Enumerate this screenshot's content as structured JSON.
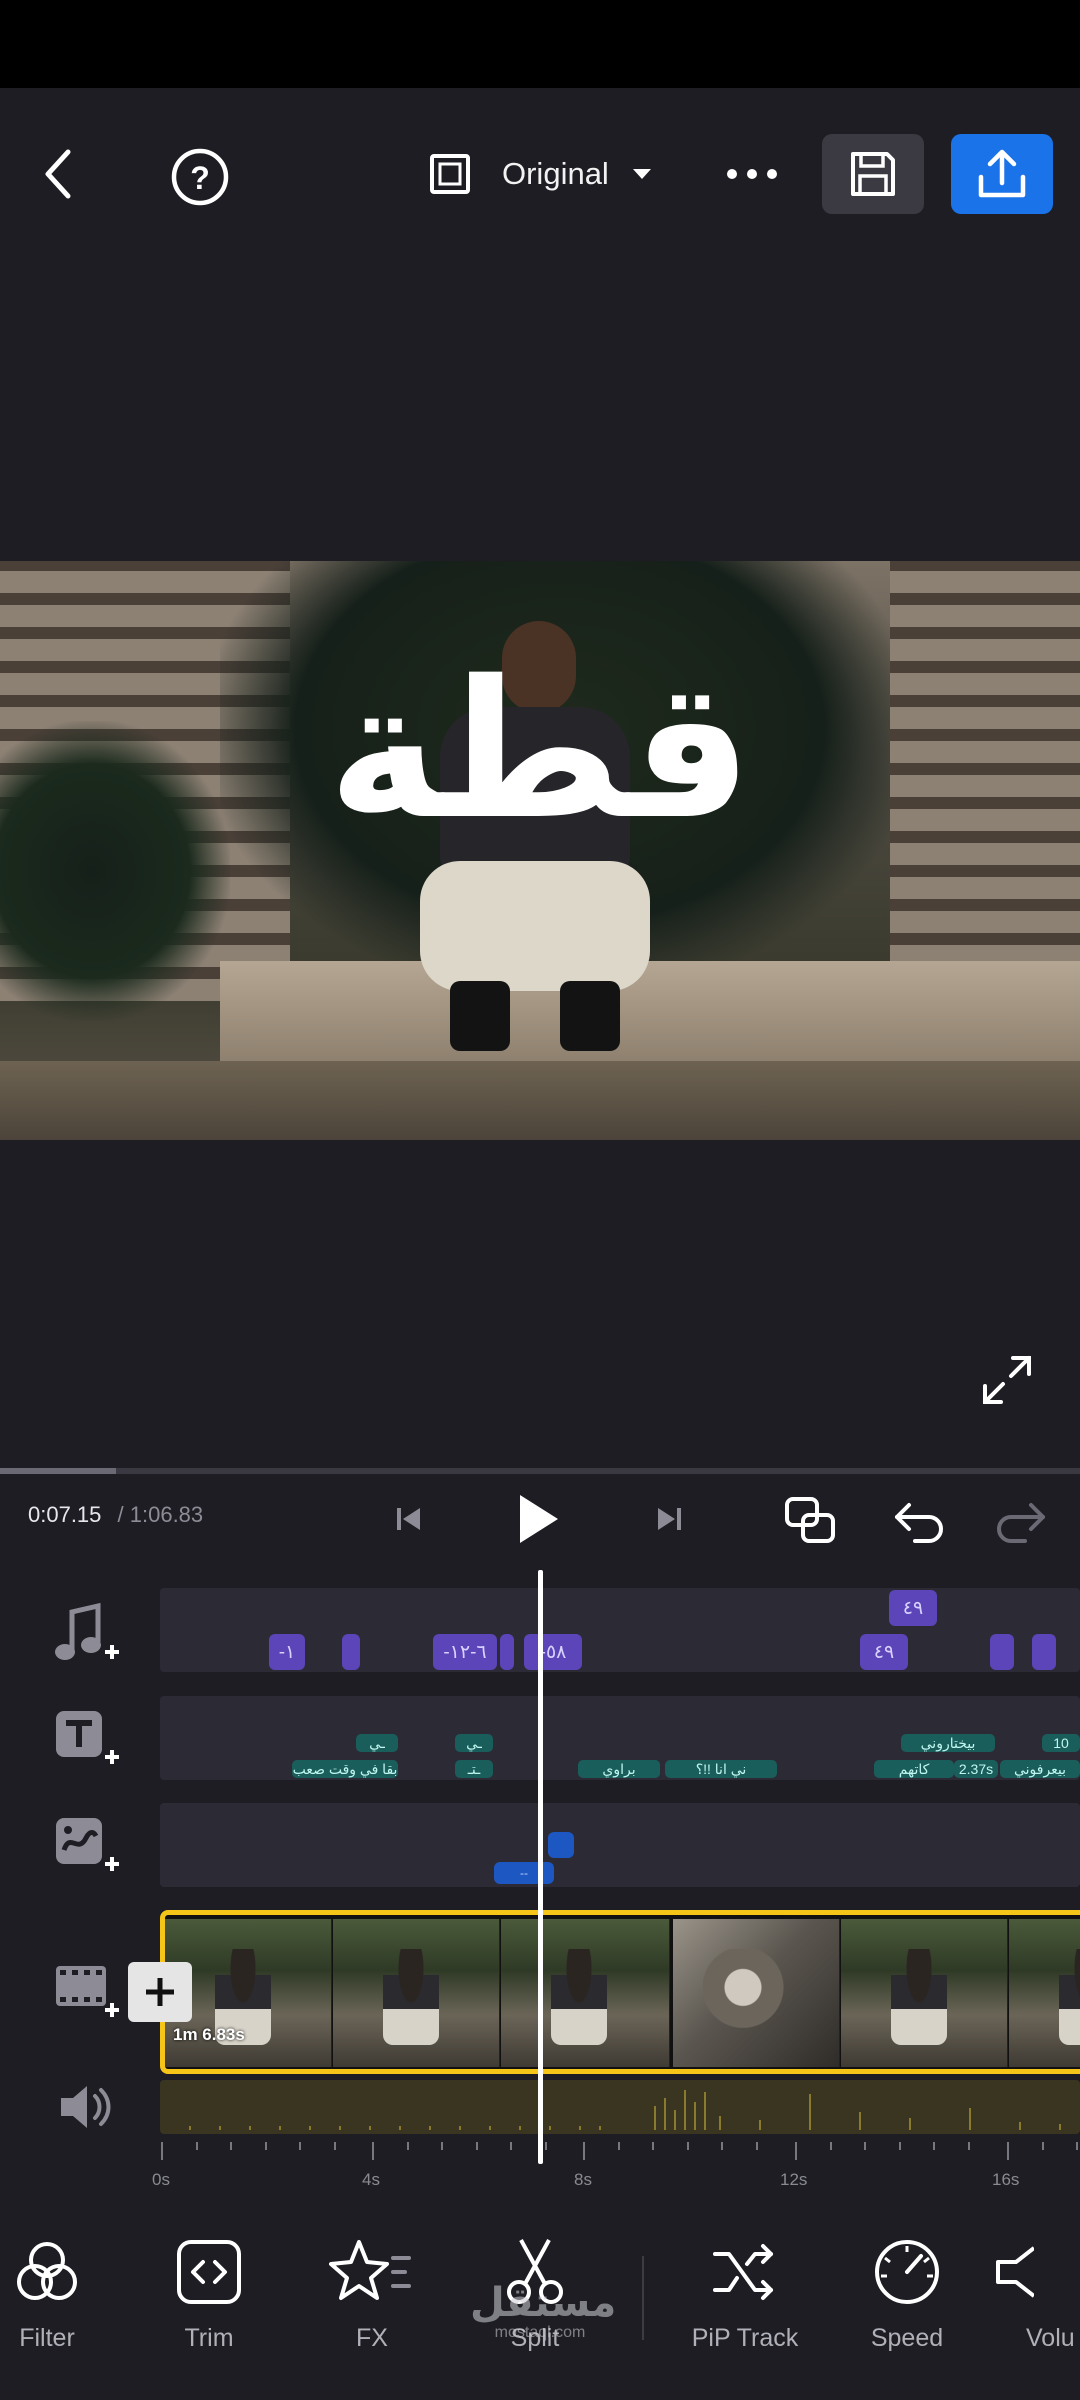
{
  "topbar": {
    "aspect_label": "Original",
    "icons": [
      "back-icon",
      "help-icon",
      "aspect-icon",
      "chevron-down-icon",
      "more-icon",
      "save-icon",
      "export-icon"
    ],
    "export_color": "#1a73e8"
  },
  "preview": {
    "overlay_text": "قطة"
  },
  "playback": {
    "current_time": "0:07.15",
    "total_time": "/ 1:06.83"
  },
  "tracks": {
    "audio_chips": [
      "٤٩",
      "-١",
      "-٦-١٢",
      "-٥٨",
      "٤٩"
    ],
    "text_chips_top": [
      "ـي",
      "ـي",
      "بيختاروني",
      "10"
    ],
    "text_chips_bottom": [
      "بقا في وقت صعب",
      "ـتـ",
      "براوي",
      "ني انا !!؟",
      "كاتهم",
      "2.37s",
      "بيعرفوني"
    ],
    "pip_chip": "--",
    "video_duration": "1m 6.83s"
  },
  "ruler": {
    "labels": [
      "0s",
      "4s",
      "8s",
      "12s",
      "16s"
    ]
  },
  "toolbar": {
    "items": [
      {
        "label": "Filter",
        "icon": "filter-icon"
      },
      {
        "label": "Trim",
        "icon": "trim-icon"
      },
      {
        "label": "FX",
        "icon": "fx-star-icon"
      },
      {
        "label": "Split",
        "icon": "scissors-icon"
      },
      {
        "label": "PiP Track",
        "icon": "shuffle-icon"
      },
      {
        "label": "Speed",
        "icon": "speedometer-icon"
      },
      {
        "label": "Volu",
        "icon": "volume-icon"
      }
    ]
  },
  "watermark": {
    "text": "مستقل",
    "sub": "mostaql.com"
  },
  "colors": {
    "background": "#1e1d24",
    "accent_blue": "#1a73e8",
    "selection_yellow": "#f5c518",
    "audio_chip": "#5b45b8",
    "text_chip": "#1a5e5c"
  }
}
